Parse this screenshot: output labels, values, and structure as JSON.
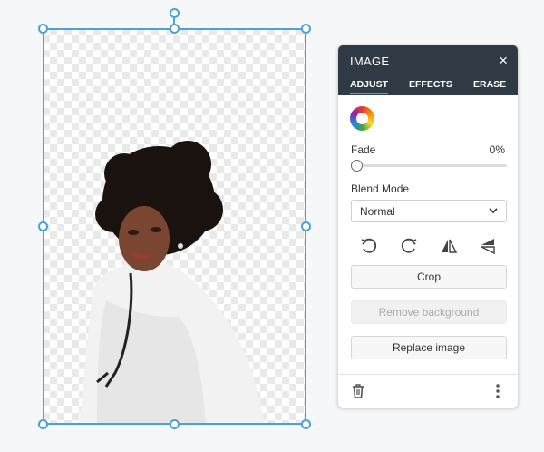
{
  "panel": {
    "title": "IMAGE",
    "close_glyph": "×",
    "tabs": [
      {
        "label": "ADJUST",
        "active": true
      },
      {
        "label": "EFFECTS",
        "active": false
      },
      {
        "label": "ERASE",
        "active": false
      }
    ],
    "fade": {
      "label": "Fade",
      "value_text": "0%",
      "value": 0
    },
    "blend_mode": {
      "label": "Blend Mode",
      "selected": "Normal"
    },
    "tools": [
      "rotate-left-icon",
      "rotate-right-icon",
      "flip-horizontal-icon",
      "flip-vertical-icon"
    ],
    "buttons": {
      "crop": "Crop",
      "remove_background": "Remove background",
      "replace_image": "Replace image"
    },
    "footer_icons": [
      "trash-icon",
      "more-icon"
    ]
  },
  "colors": {
    "accent": "#4aa3d6",
    "header_bg": "#2f3a45"
  }
}
